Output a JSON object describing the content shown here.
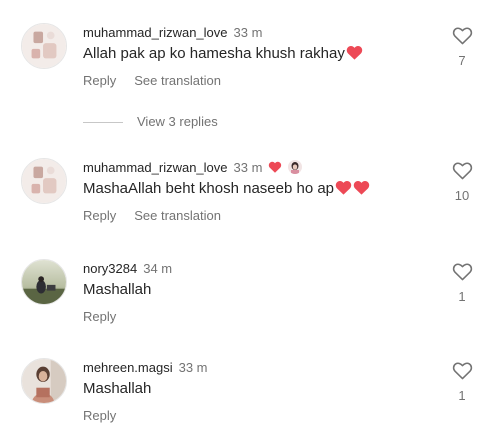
{
  "comments": [
    {
      "username": "muhammad_rizwan_love",
      "time": "33 m",
      "text": "Allah pak ap ko hamesha khush rakhay",
      "reply": "Reply",
      "see_translation": "See translation",
      "likes": "7"
    },
    {
      "username": "muhammad_rizwan_love",
      "time": "33 m",
      "text": "MashaAllah beht khosh naseeb ho ap",
      "reply": "Reply",
      "see_translation": "See translation",
      "likes": "10"
    },
    {
      "username": "nory3284",
      "time": "34 m",
      "text": "Mashallah",
      "reply": "Reply",
      "likes": "1"
    },
    {
      "username": "mehreen.magsi",
      "time": "33 m",
      "text": "Mashallah",
      "reply": "Reply",
      "likes": "1"
    }
  ],
  "view_replies": "View 3 replies",
  "icons": {
    "like": "heart-outline-icon",
    "emoji_heart": "red-heart-emoji",
    "liked_by_author": "red-heart-icon"
  },
  "colors": {
    "text": "#262626",
    "secondary": "#737373",
    "heart_red": "#ed4956"
  }
}
